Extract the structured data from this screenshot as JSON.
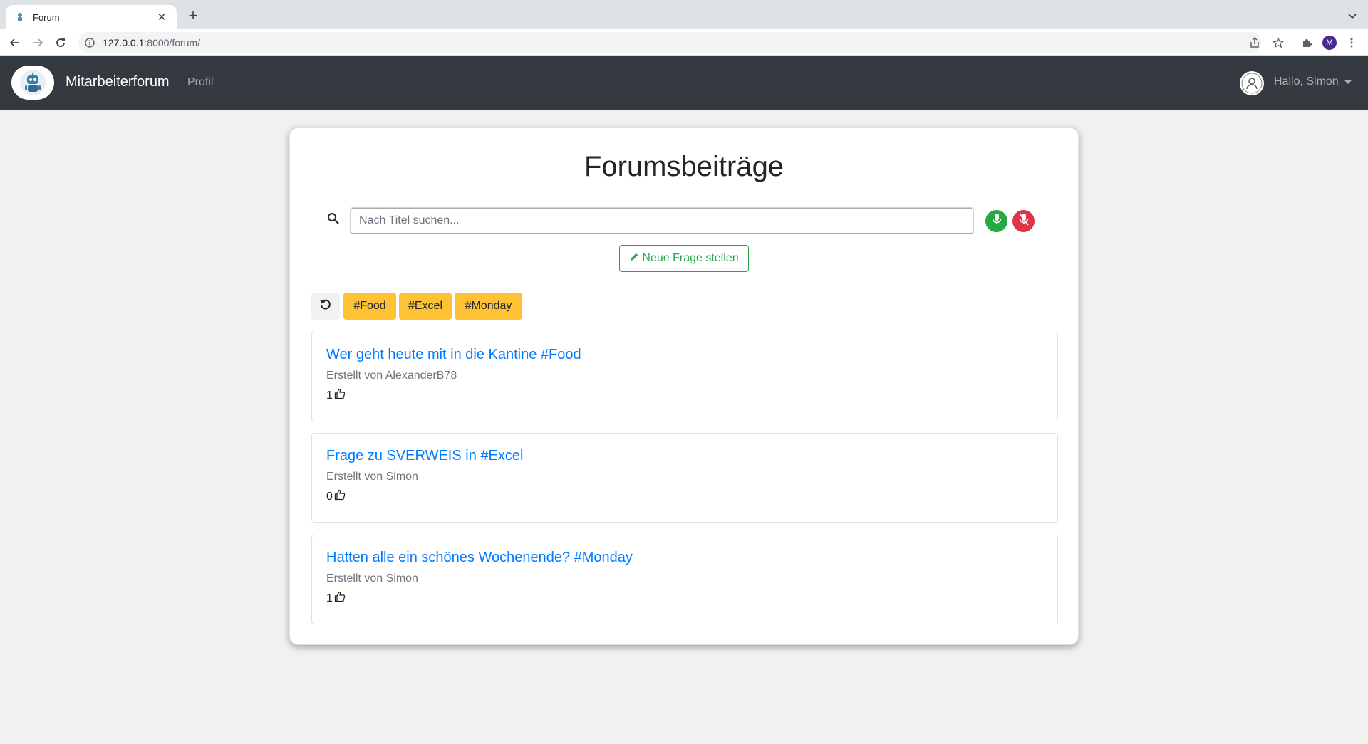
{
  "browser": {
    "tab_title": "Forum",
    "url_host": "127.0.0.1",
    "url_path": ":8000/forum/",
    "profile_initial": "M"
  },
  "navbar": {
    "brand": "Mitarbeiterforum",
    "profile_link": "Profil",
    "greeting": "Hallo, Simon"
  },
  "main": {
    "title": "Forumsbeiträge",
    "search_placeholder": "Nach Titel suchen...",
    "new_question_label": "Neue Frage stellen",
    "tags": [
      "#Food",
      "#Excel",
      "#Monday"
    ],
    "posts": [
      {
        "title": "Wer geht heute mit in die Kantine #Food",
        "author": "Erstellt von AlexanderB78",
        "likes": "1"
      },
      {
        "title": "Frage zu SVERWEIS in #Excel",
        "author": "Erstellt von Simon",
        "likes": "0"
      },
      {
        "title": "Hatten alle ein schönes Wochenende? #Monday",
        "author": "Erstellt von Simon",
        "likes": "1"
      }
    ]
  },
  "colors": {
    "navbar_bg": "#343a40",
    "tag_bg": "#ffc234",
    "link_blue": "#007bff",
    "success_green": "#28a745",
    "danger_red": "#dc3545"
  },
  "icons": [
    "search-icon",
    "microphone-icon",
    "microphone-off-icon",
    "pencil-icon",
    "reset-icon",
    "thumbs-up-icon",
    "user-icon",
    "robot-logo-icon"
  ]
}
